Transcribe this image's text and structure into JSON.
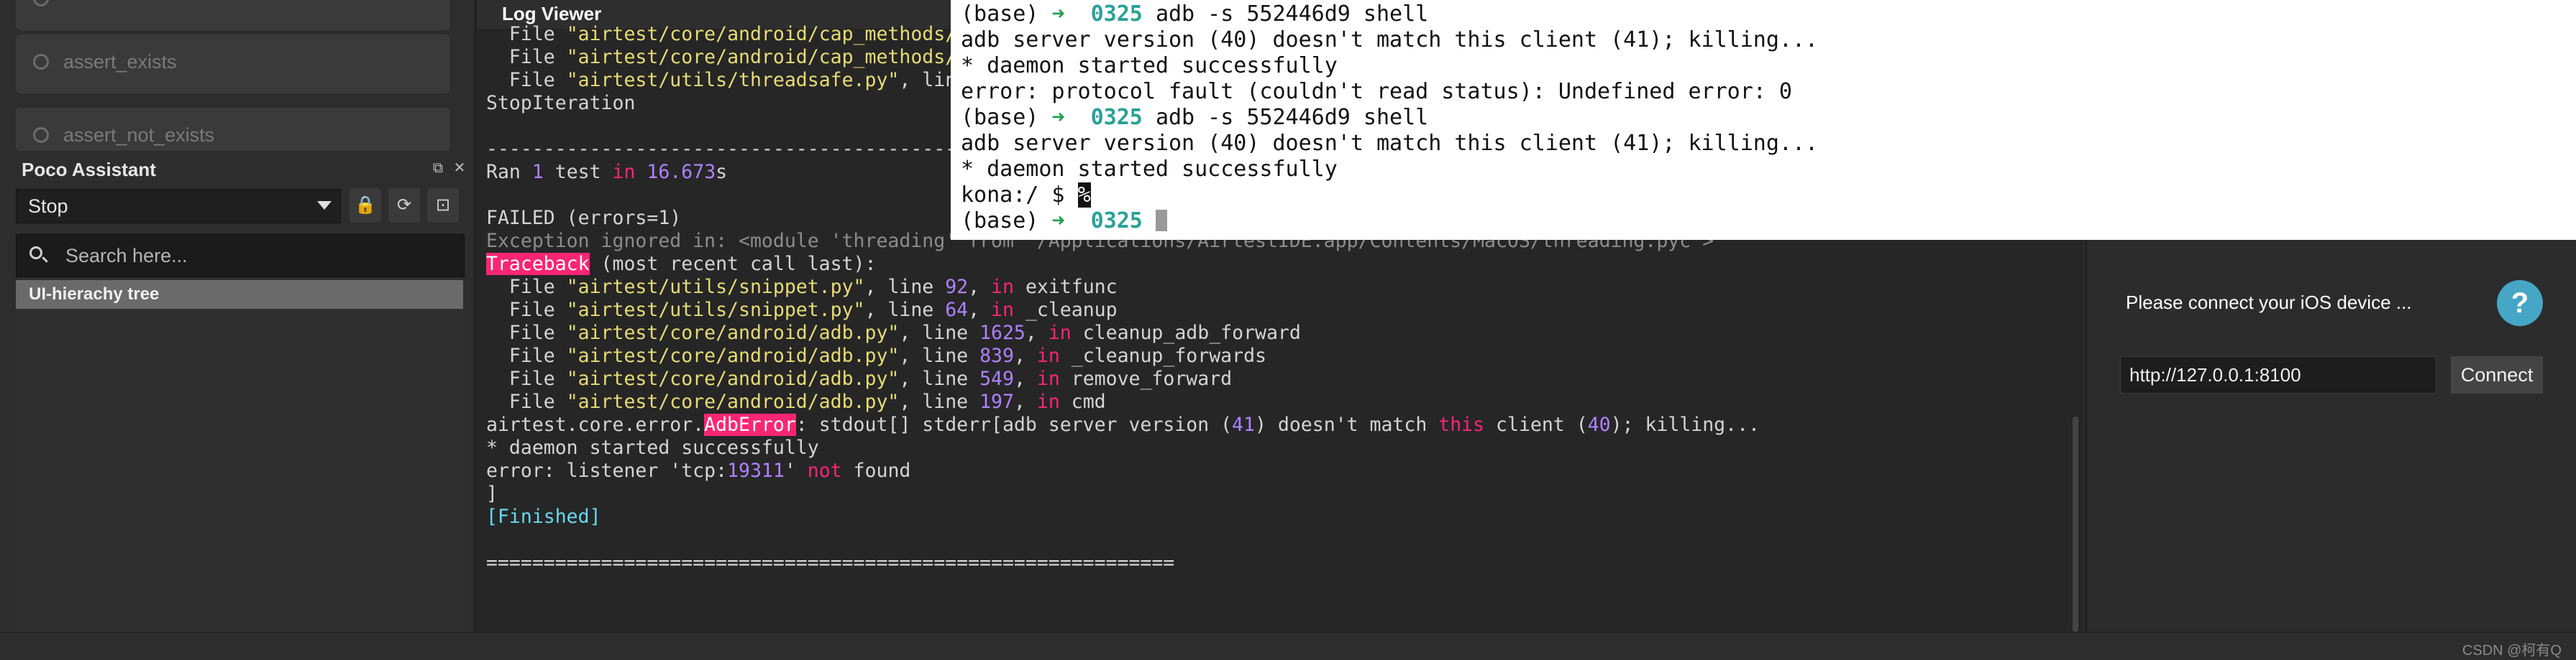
{
  "left_panel": {
    "commands": [
      {
        "label": "",
        "icon": "circle-icon"
      },
      {
        "label": "assert_exists",
        "icon": "target-icon"
      },
      {
        "label": "assert_not_exists",
        "icon": "cancel-icon"
      }
    ],
    "poco": {
      "title": "Poco Assistant",
      "mode_select": "Stop",
      "search_placeholder": "Search here...",
      "tree_root": "UI-hierachy tree"
    }
  },
  "log_viewer": {
    "title": "Log Viewer",
    "exception_prefix": "Exception ignored in: <module 'threading' from '/Applications/AirtestIDE.app/Contents/MacOS/threading.pyc'>",
    "ran_summary": {
      "text_before": "Ran ",
      "count": "1",
      "text_mid": " test ",
      "kw": "in",
      "time": "16.673",
      "text_after": "s"
    },
    "failed_line": "FAILED (errors=1)",
    "traceback_header": "Traceback",
    "traceback_suffix": " (most recent call last):",
    "frames_top": [
      {
        "file": "\"airtest/core/android/cap_methods/b",
        "line": "",
        "func": ""
      },
      {
        "file": "\"airtest/core/android/cap_methods/j",
        "line": "",
        "func": ""
      },
      {
        "file": "\"airtest/utils/threadsafe.py\"",
        "line": "",
        "func": ""
      }
    ],
    "frames": [
      {
        "file": "\"airtest/utils/snippet.py\"",
        "line": "92",
        "func": "exitfunc"
      },
      {
        "file": "\"airtest/utils/snippet.py\"",
        "line": "64",
        "func": "_cleanup"
      },
      {
        "file": "\"airtest/core/android/adb.py\"",
        "line": "1625",
        "func": "cleanup_adb_forward"
      },
      {
        "file": "\"airtest/core/android/adb.py\"",
        "line": "839",
        "func": "_cleanup_forwards"
      },
      {
        "file": "\"airtest/core/android/adb.py\"",
        "line": "549",
        "func": "remove_forward"
      },
      {
        "file": "\"airtest/core/android/adb.py\"",
        "line": "197",
        "func": "cmd"
      }
    ],
    "stop_iteration": "StopIteration",
    "error_line": {
      "prefix": "airtest.core.error.",
      "error_name": "AdbError",
      "middle": ": stdout[] stderr[adb server version (",
      "v1": "41",
      "text2": ") doesn't match ",
      "kw": "this",
      "text3": " client (",
      "v2": "40",
      "text4": "); killing..."
    },
    "daemon_line": "* daemon started successfully",
    "listener_line": {
      "prefix": "error: listener 'tcp:",
      "port": "19311",
      "mid": "' ",
      "kw": "not",
      "suffix": " found"
    },
    "bracket": "]",
    "finished": "[Finished]",
    "separator": "============================================================"
  },
  "terminal": {
    "lines": [
      {
        "type": "prompt",
        "env": "(base)",
        "arrow": "➜",
        "dir": "0325",
        "cmd": "adb -s 552446d9 shell"
      },
      {
        "type": "text",
        "text": "adb server version (40) doesn't match this client (41); killing..."
      },
      {
        "type": "text",
        "text": "* daemon started successfully"
      },
      {
        "type": "text",
        "text": "error: protocol fault (couldn't read status): Undefined error: 0"
      },
      {
        "type": "prompt",
        "env": "(base)",
        "arrow": "➜",
        "dir": "0325",
        "cmd": "adb -s 552446d9 shell"
      },
      {
        "type": "text",
        "text": "adb server version (40) doesn't match this client (41); killing..."
      },
      {
        "type": "text",
        "text": "* daemon started successfully"
      },
      {
        "type": "shell",
        "prompt": "kona:/ $ ",
        "sel": "%"
      },
      {
        "type": "prompt-cursor",
        "env": "(base)",
        "arrow": "➜",
        "dir": "0325"
      }
    ]
  },
  "ios_panel": {
    "message": "Please connect your iOS device ...",
    "help_label": "?",
    "url_value": "http://127.0.0.1:8100",
    "connect_label": "Connect"
  },
  "status_bar": {
    "watermark": "CSDN @柯有Q"
  },
  "colors": {
    "accent": "#f92672",
    "string": "#e6db74",
    "number": "#ae81ff",
    "help": "#46a6c6"
  }
}
